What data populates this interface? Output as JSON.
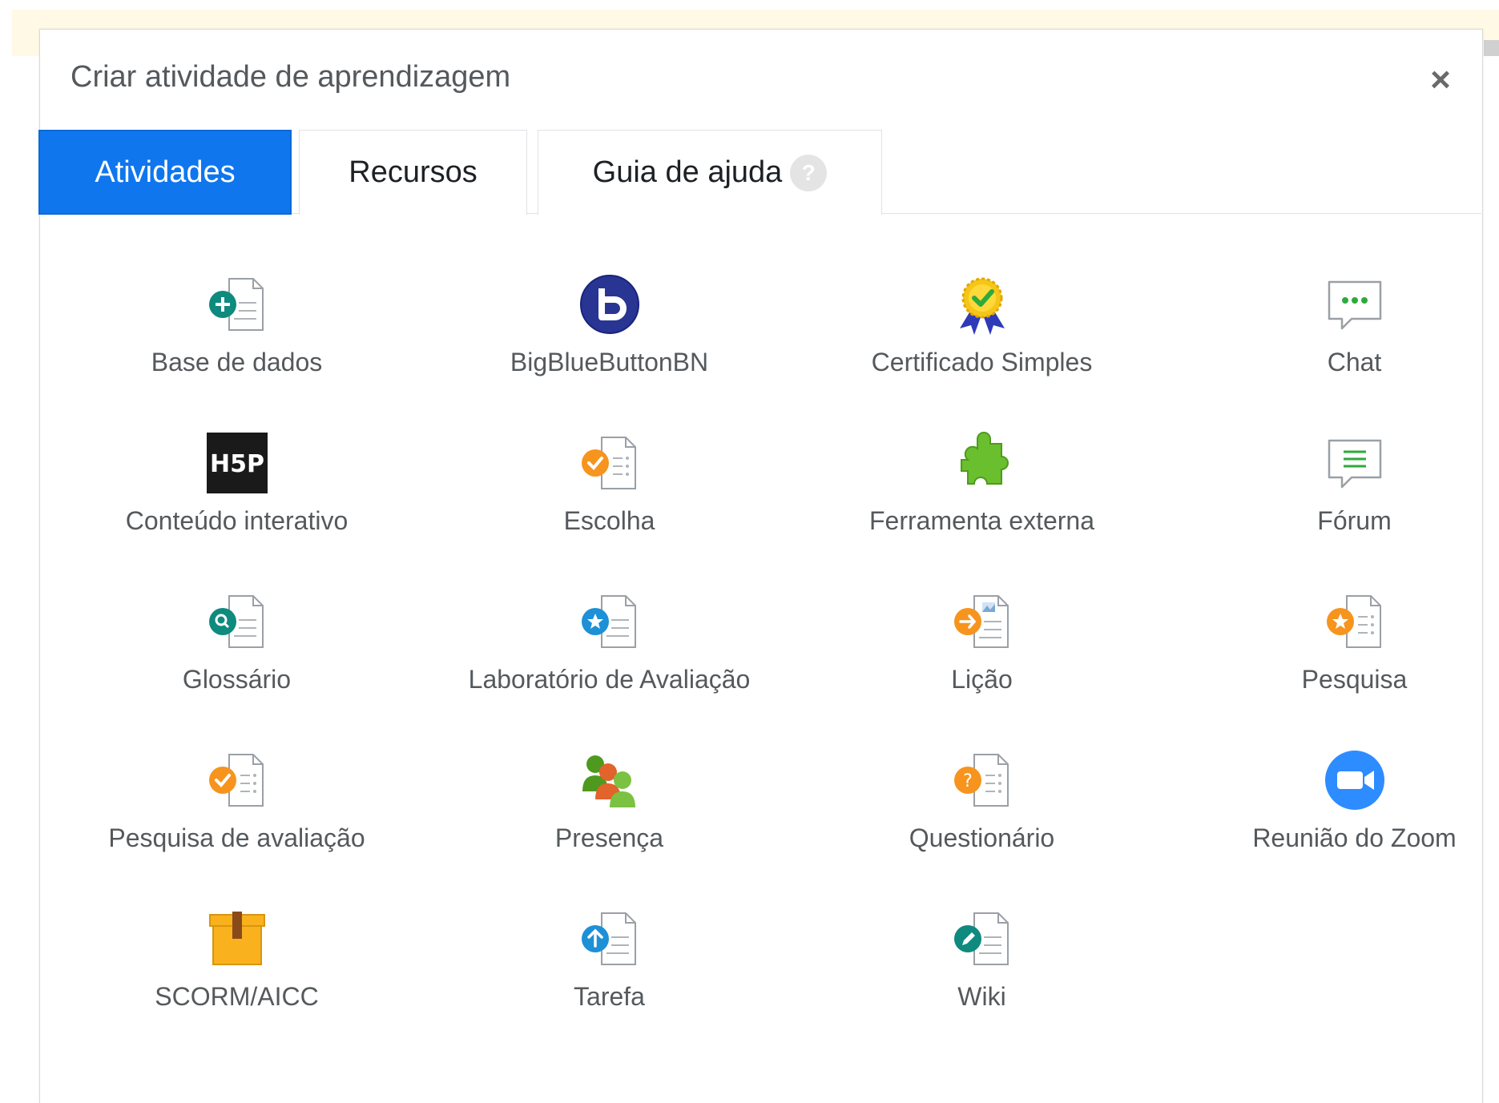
{
  "dialog": {
    "title": "Criar atividade de aprendizagem",
    "close_label": "×"
  },
  "tabs": [
    {
      "label": "Atividades",
      "active": true
    },
    {
      "label": "Recursos",
      "active": false
    },
    {
      "label": "Guia de ajuda",
      "active": false,
      "badge": "?"
    }
  ],
  "colors": {
    "accent": "#0f76ee",
    "text_muted": "#55595c",
    "banner": "#fff9e6"
  },
  "activities": [
    {
      "label": "Base de dados",
      "icon": "database-icon"
    },
    {
      "label": "BigBlueButtonBN",
      "icon": "bigbluebutton-icon"
    },
    {
      "label": "Certificado Simples",
      "icon": "certificate-icon"
    },
    {
      "label": "Chat",
      "icon": "chat-icon"
    },
    {
      "label": "Conteúdo interativo",
      "icon": "h5p-icon"
    },
    {
      "label": "Escolha",
      "icon": "choice-icon"
    },
    {
      "label": "Ferramenta externa",
      "icon": "puzzle-icon"
    },
    {
      "label": "Fórum",
      "icon": "forum-icon"
    },
    {
      "label": "Glossário",
      "icon": "glossary-icon"
    },
    {
      "label": "Laboratório de Avaliação",
      "icon": "workshop-icon"
    },
    {
      "label": "Lição",
      "icon": "lesson-icon"
    },
    {
      "label": "Pesquisa",
      "icon": "survey-icon"
    },
    {
      "label": "Pesquisa de avaliação",
      "icon": "feedback-icon"
    },
    {
      "label": "Presença",
      "icon": "attendance-icon"
    },
    {
      "label": "Questionário",
      "icon": "quiz-icon"
    },
    {
      "label": "Reunião do Zoom",
      "icon": "zoom-icon"
    },
    {
      "label": "SCORM/AICC",
      "icon": "scorm-package-icon"
    },
    {
      "label": "Tarefa",
      "icon": "assignment-icon"
    },
    {
      "label": "Wiki",
      "icon": "wiki-icon"
    }
  ]
}
